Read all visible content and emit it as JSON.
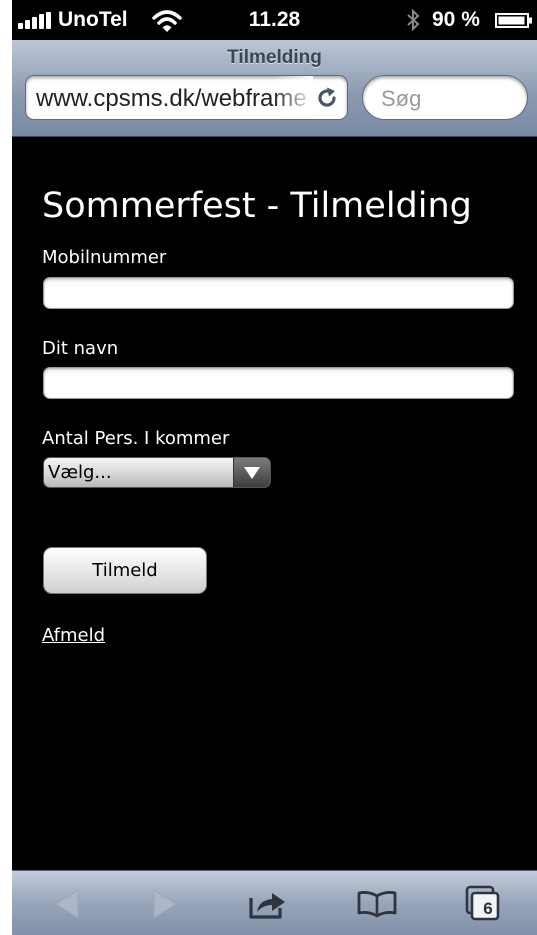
{
  "status_bar": {
    "carrier": "UnoTel",
    "time": "11.28",
    "battery": "90 %",
    "icons": [
      "signal-bars-icon",
      "wifi-icon",
      "bluetooth-icon",
      "battery-icon"
    ]
  },
  "browser": {
    "page_title": "Tilmelding",
    "url": "www.cpsms.dk/webframe",
    "search_placeholder": "Søg",
    "tab_count": "6",
    "toolbar_icons": [
      "back-arrow-icon",
      "forward-arrow-icon",
      "share-icon",
      "bookmarks-icon",
      "tabs-icon"
    ]
  },
  "form": {
    "heading": "Sommerfest - Tilmelding",
    "phone_label": "Mobilnummer",
    "phone_value": "",
    "name_label": "Dit navn",
    "name_value": "",
    "persons_label": "Antal Pers. I kommer",
    "persons_selected": "Vælg...",
    "submit_label": "Tilmeld",
    "unsubscribe_label": "Afmeld"
  },
  "colors": {
    "page_background": "#000000",
    "chrome_top": "#bcc7d6",
    "chrome_bottom": "#7889a3",
    "text_on_page": "#ffffff"
  }
}
